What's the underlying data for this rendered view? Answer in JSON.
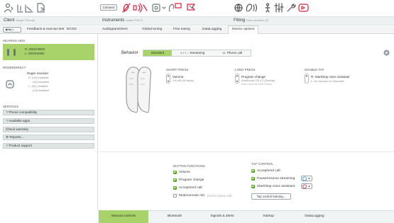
{
  "toolbar": {
    "connect_label": "Connect"
  },
  "header": {
    "client_label": "Client",
    "client_target": "Target: Phonak",
    "instruments_label": "Instruments",
    "instruments_value": "Audéo P90-R",
    "fitting_label": "Fitting",
    "fitting_value": "Calm situation (2)"
  },
  "nav_tabs": [
    "Feedback & real ear test",
    "ECGD",
    "AudiogramDirect",
    "Global tuning",
    "Fine tuning",
    "DataLogging",
    "Device options"
  ],
  "sidebar": {
    "hearing_aids_heading": "HEARING AIDS",
    "ha_right": "R: 2002/H0802",
    "ha_left": "L: 2002/H0802",
    "roger_heading": "ROGERDIRECT",
    "roger_name": "Roger receiver",
    "roger_r": "R: (02) installed",
    "roger_r2": "(03) installed",
    "roger_l": "L: (02) installed",
    "roger_l2": "(03) installed",
    "services_heading": "SERVICES",
    "services": [
      "Phone compatibility",
      "Available apps",
      "Check warranty",
      "Reports...",
      "Product support"
    ]
  },
  "behavior": {
    "label": "Behavior",
    "tabs": [
      "Standard",
      "Streaming",
      "Phone call"
    ],
    "tab2_prefix": "⊕ ♦ ¶ ♫"
  },
  "press": {
    "short_heading": "SHORT PRESS",
    "short_title": "Volume",
    "short_sub": "±10 dB (±5 steps)",
    "long_heading": "LONG PRESS",
    "long_title": "Program change",
    "long_sub1": "AutoSense OS 4.0 (Startup)",
    "long_sub2": "Action does has same function",
    "double_heading": "DOUBLE TAP",
    "double_r": "R: Start/stop voice assistant",
    "double_l": "L: No function in Standard"
  },
  "button_functions": {
    "heading": "BUTTON FUNCTIONS",
    "items": [
      "Volume",
      "Program change",
      "Accept/end call",
      "Mute/unmute mic"
    ],
    "mute_note": "(not for phone call)"
  },
  "tap_control": {
    "heading": "TAP CONTROL",
    "items": [
      "Accept/end call",
      "Pause/resume streaming",
      "Start/stop voice assistant"
    ],
    "training_button": "Tap control training..."
  },
  "bottom_tabs": [
    "Manual controls",
    "Bluetooth",
    "Signals & alerts",
    "Startup",
    "DataLogging"
  ],
  "colors": {
    "accent_green": "#a8d26a",
    "dark_green": "#5da52a",
    "red": "#d81f3d",
    "blue": "#2d7fd0"
  }
}
